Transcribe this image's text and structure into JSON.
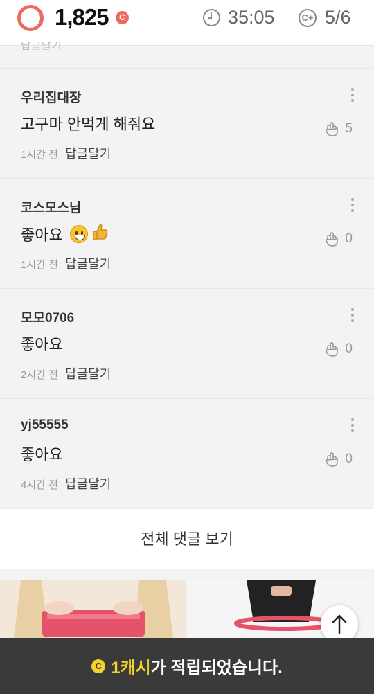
{
  "header": {
    "points": "1,825",
    "points_badge": "C",
    "timer": "35:05",
    "cplus_symbol": "C+",
    "progress": "5/6",
    "accent_color": "#ec6a5e"
  },
  "partial_text": "답글달기",
  "comments": [
    {
      "author": "우리집대장",
      "text": "고구마 안먹게 해줘요",
      "time": "1시간 전",
      "reply": "답글달기",
      "likes": "5"
    },
    {
      "author": "코스모스님",
      "text": "좋아요",
      "time": "1시간 전",
      "reply": "답글달기",
      "likes": "0",
      "emojis": [
        "grinning-face",
        "thumbs-up"
      ]
    },
    {
      "author": "모모0706",
      "text": "좋아요",
      "time": "2시간 전",
      "reply": "답글달기",
      "likes": "0"
    },
    {
      "author": "yj55555",
      "text": "좋아요",
      "time": "4시간 전",
      "reply": "답글달기",
      "likes": "0"
    }
  ],
  "view_all_label": "전체 댓글 보기",
  "toast": {
    "icon": "C",
    "highlight": "1캐시",
    "message": "가 적립되었습니다.",
    "highlight_color": "#f4d22e"
  }
}
